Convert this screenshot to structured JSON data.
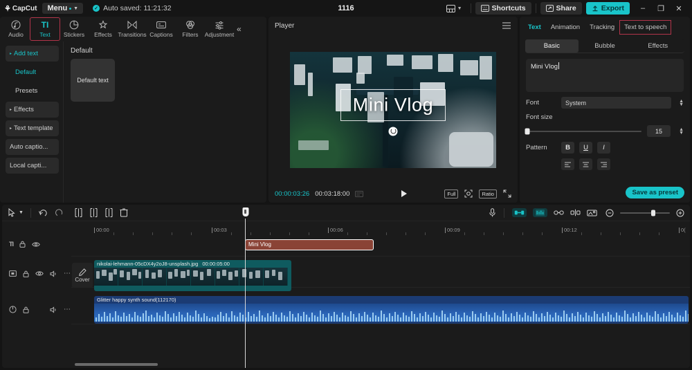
{
  "titlebar": {
    "app_name": "CapCut",
    "menu_label": "Menu",
    "autosave_text": "Auto saved: 11:21:32",
    "project_title": "1116",
    "layout_icon": "layout-icon",
    "shortcuts_label": "Shortcuts",
    "share_label": "Share",
    "export_label": "Export",
    "minimize": "–",
    "maximize": "❐",
    "close": "✕",
    "accent_color": "#19c4c9",
    "highlight_box_color": "#b2344a"
  },
  "left_panel": {
    "tabs": [
      {
        "label": "Audio",
        "icon": "music-note-icon",
        "active": false
      },
      {
        "label": "Text",
        "icon": "text-tt-icon",
        "active": true
      },
      {
        "label": "Stickers",
        "icon": "sticker-icon",
        "active": false
      },
      {
        "label": "Effects",
        "icon": "sparkle-icon",
        "active": false
      },
      {
        "label": "Transitions",
        "icon": "transition-icon",
        "active": false
      },
      {
        "label": "Captions",
        "icon": "captions-icon",
        "active": false
      },
      {
        "label": "Filters",
        "icon": "filters-icon",
        "active": false
      },
      {
        "label": "Adjustment",
        "icon": "adjustment-sliders-icon",
        "active": false
      }
    ],
    "collapse_icon": "«",
    "nav_items": [
      {
        "label": "Add text",
        "group": true,
        "selected": true,
        "arrow": "▸"
      },
      {
        "label": "Default",
        "group": false,
        "selected": true,
        "indent": true
      },
      {
        "label": "Presets",
        "group": false,
        "selected": false,
        "indent": true
      },
      {
        "label": "Effects",
        "group": true,
        "selected": false,
        "arrow": "▸"
      },
      {
        "label": "Text template",
        "group": true,
        "selected": false,
        "arrow": "▸"
      },
      {
        "label": "Auto captio...",
        "group": true,
        "selected": false
      },
      {
        "label": "Local capti...",
        "group": true,
        "selected": false
      }
    ],
    "content_header": "Default",
    "preset_card_label": "Default text"
  },
  "player": {
    "title": "Player",
    "menu_icon": "hamburger-icon",
    "overlay_text": "Mini Vlog",
    "current_time": "00:00:03:26",
    "total_time": "00:03:18:00",
    "play_icon": "play-icon",
    "full_label": "Full",
    "fit_icon": "fit-screen-icon",
    "ratio_label": "Ratio",
    "fullscreen_icon": "fullscreen-icon"
  },
  "right_panel": {
    "tabs": [
      {
        "label": "Text",
        "active": true,
        "boxed": false
      },
      {
        "label": "Animation",
        "active": false,
        "boxed": false
      },
      {
        "label": "Tracking",
        "active": false,
        "boxed": false
      },
      {
        "label": "Text to speech",
        "active": false,
        "boxed": true
      }
    ],
    "segments": [
      {
        "label": "Basic",
        "active": true
      },
      {
        "label": "Bubble",
        "active": false
      },
      {
        "label": "Effects",
        "active": false
      }
    ],
    "text_value": "Mini Vlog",
    "font_label": "Font",
    "font_value": "System",
    "font_size_label": "Font size",
    "font_size_value": "15",
    "pattern_label": "Pattern",
    "pattern_buttons": [
      "B",
      "U",
      "I"
    ],
    "save_preset_label": "Save as preset"
  },
  "timeline": {
    "tools_left": [
      {
        "name": "select-cursor-icon"
      },
      {
        "name": "chevron-down-icon"
      },
      {
        "name": "undo-icon"
      },
      {
        "name": "redo-icon"
      },
      {
        "name": "split-icon"
      },
      {
        "name": "split-left-icon"
      },
      {
        "name": "split-right-icon"
      },
      {
        "name": "delete-icon"
      }
    ],
    "tools_right": [
      {
        "name": "microphone-icon",
        "on": false
      },
      {
        "name": "auto-clip-icon",
        "on": true
      },
      {
        "name": "auto-beat-icon",
        "on": true
      },
      {
        "name": "link-icon",
        "on": false
      },
      {
        "name": "mirror-icon",
        "on": false
      },
      {
        "name": "cover-frame-icon",
        "on": false
      },
      {
        "name": "zoom-out-icon",
        "on": false
      },
      {
        "name": "zoom-in-icon",
        "on": false
      }
    ],
    "ruler_labels": [
      "00:00",
      "00:03",
      "00:06",
      "00:09",
      "00:12",
      "0("
    ],
    "cover_label": "Cover",
    "tracks": [
      {
        "type": "text",
        "header_icon": "text-tt-icon",
        "controls": [
          "lock-icon",
          "eye-icon"
        ],
        "clip_label": "Mini Vlog",
        "selected": true
      },
      {
        "type": "video",
        "header_icon": "video-icon",
        "controls": [
          "lock-icon",
          "eye-icon",
          "volume-icon",
          "more-icon"
        ],
        "clip_label": "nikolai-lehmann-05cDX4y2oJ8-unsplash.jpg",
        "clip_duration": "00:00:05:00"
      },
      {
        "type": "audio",
        "header_icon": "power-icon",
        "controls": [
          "lock-icon",
          "volume-icon",
          "more-icon"
        ],
        "clip_label": "Glitter happy synth sound(112170)"
      }
    ]
  }
}
